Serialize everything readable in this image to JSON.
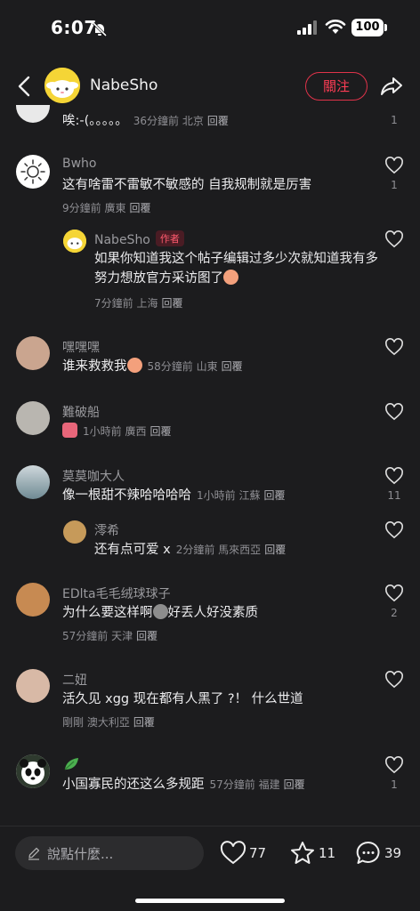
{
  "status": {
    "time": "6:07",
    "battery": "100"
  },
  "header": {
    "username": "NabeSho",
    "follow_label": "關注"
  },
  "comments": [
    {
      "text": "唉:-(。。。。。",
      "time": "36分鐘前",
      "location": "北京",
      "reply": "回覆",
      "likes": "1"
    },
    {
      "username": "Bwho",
      "text": "这有啥雷不雷敏不敏感的 自我规制就是厉害",
      "time": "9分鐘前",
      "location": "廣東",
      "reply": "回覆",
      "likes": "1"
    },
    {
      "username": "NabeSho",
      "badge": "作者",
      "text": "如果你知道我这个帖子编辑过多少次就知道我有多努力想放官方采访图了",
      "time": "7分鐘前",
      "location": "上海",
      "reply": "回覆",
      "likes": ""
    },
    {
      "username": "嘿嘿嘿",
      "text": "谁来救救我",
      "time": "58分鐘前",
      "location": "山東",
      "reply": "回覆",
      "likes": ""
    },
    {
      "username": "難破船",
      "text": "",
      "time": "1小時前",
      "location": "廣西",
      "reply": "回覆",
      "likes": ""
    },
    {
      "username": "莫莫咖大人",
      "text": "像一根甜不辣哈哈哈哈",
      "time": "1小時前",
      "location": "江蘇",
      "reply": "回覆",
      "likes": "11"
    },
    {
      "username": "澪希",
      "text": "还有点可爱 x",
      "time": "2分鐘前",
      "location": "馬來西亞",
      "reply": "回覆",
      "likes": ""
    },
    {
      "username": "EDlta毛毛绒球球子",
      "text_a": "为什么要这样啊",
      "text_b": "好丢人好没素质",
      "time": "57分鐘前",
      "location": "天津",
      "reply": "回覆",
      "likes": "2"
    },
    {
      "username": "二妞",
      "text": "活久见 xgg 现在都有人黑了 ?！ 什么世道",
      "time": "剛剛",
      "location": "澳大利亞",
      "reply": "回覆",
      "likes": ""
    },
    {
      "username": "",
      "text": "小国寡民的还这么多规距",
      "time": "57分鐘前",
      "location": "福建",
      "reply": "回覆",
      "likes": "1"
    }
  ],
  "bottom": {
    "placeholder": "說點什麼...",
    "likes": "77",
    "stars": "11",
    "comments": "39"
  },
  "colors": {
    "accent": "#ff3d55",
    "background": "#1c1c1e"
  }
}
